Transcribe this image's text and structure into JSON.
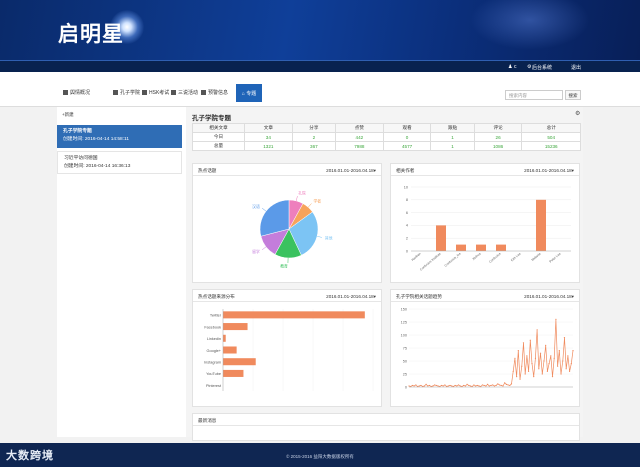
{
  "header": {
    "brand": "启明星"
  },
  "userbar": {
    "user": "c",
    "system": "后台系统",
    "logout": "退出"
  },
  "nav": {
    "tabs": [
      {
        "label": "舆情概况"
      },
      {
        "label": "孔子学院"
      },
      {
        "label": "HSK考试"
      },
      {
        "label": "三说活动"
      },
      {
        "label": "预警信息"
      },
      {
        "label": "专题"
      }
    ],
    "search_placeholder": "搜索内容",
    "search_button": "搜索"
  },
  "sidebar": {
    "new_button": "+新建",
    "items": [
      {
        "title": "孔子学院专题",
        "meta": "创建时间:   2016-04-14 14:58:11"
      },
      {
        "title": "习近平访问德国",
        "meta": "创建时间:   2016-04-14 16:36:13"
      }
    ]
  },
  "main": {
    "title": "孔子学院专题",
    "stats": {
      "headers": [
        "相关文章",
        "文章",
        "分享",
        "点赞",
        "观看",
        "跟贴",
        "评论",
        "总计"
      ],
      "rows": [
        {
          "label": "今日",
          "values": [
            "34",
            "2",
            "442",
            "0",
            "1",
            "26",
            "504"
          ]
        },
        {
          "label": "总量",
          "values": [
            "1321",
            "367",
            "7988",
            "4577",
            "1",
            "1086",
            "15236"
          ]
        }
      ]
    }
  },
  "panels": {
    "hot_topics": {
      "title": "热点话题",
      "range": "2016.01.01-2016.04.18▾"
    },
    "authors": {
      "title": "相关作者",
      "range": "2016.01.01-2016.04.18▾"
    },
    "source": {
      "title": "热点话题来源分布",
      "range": "2016.01.01-2016.04.18▾"
    },
    "trend": {
      "title": "孔子学院相关话题趋势",
      "range": "2016.01.01-2016.04.18▾"
    },
    "latest": {
      "title": "最新消息"
    }
  },
  "footer": {
    "copyright": "© 2015-2016 益阳大数据版权所有"
  },
  "watermark": "大数跨境",
  "colors": {
    "accent": "#1f64b8",
    "bar": "#f08a5d",
    "banner": "#0f3f99"
  },
  "chart_data": [
    {
      "type": "pie",
      "categories": [
        "孔院",
        "学者",
        "其他",
        "教育",
        "留学",
        "汉语"
      ],
      "values": [
        8,
        7,
        28,
        15,
        13,
        29
      ],
      "colors": [
        "#ee7fbd",
        "#f7a35c",
        "#7cc4f4",
        "#3ac25f",
        "#c47ddb",
        "#5b9ae8"
      ]
    },
    {
      "type": "bar",
      "categories": [
        "Hanban",
        "Confucius Institute",
        "Confucius_Ins",
        "Xinhua",
        "Confucius",
        "Kirk Lee",
        "Melanie",
        "Peter Lee"
      ],
      "values": [
        0,
        4,
        1,
        1,
        1,
        0,
        8,
        0
      ],
      "ylim": [
        0,
        10
      ]
    },
    {
      "type": "bar",
      "orientation": "horizontal",
      "categories": [
        "Twitter",
        "Facebook",
        "Linkedin",
        "Google+",
        "Instagram",
        "YouTube",
        "Pinterest"
      ],
      "values": [
        520,
        90,
        10,
        50,
        120,
        75,
        0
      ],
      "xlim": [
        0,
        550
      ]
    },
    {
      "type": "line",
      "ylim": [
        0,
        150
      ],
      "series": [
        {
          "values": [
            2,
            1,
            3,
            2,
            4,
            1,
            2,
            3,
            1,
            2,
            5,
            2,
            3,
            1,
            2,
            4,
            3,
            2,
            1,
            3,
            2,
            4,
            1,
            2,
            3,
            2,
            1,
            3,
            2,
            4,
            2,
            1,
            3,
            2,
            5,
            3,
            2,
            1,
            4,
            2,
            3,
            2,
            1,
            4,
            3,
            2,
            5,
            2,
            3,
            4,
            2,
            3,
            6,
            4,
            3,
            2,
            8,
            5,
            4,
            3,
            6,
            30,
            55,
            20,
            70,
            15,
            40,
            85,
            25,
            60,
            30,
            90,
            45,
            20,
            55,
            110,
            35,
            65,
            25,
            50,
            80,
            30,
            45,
            60,
            20,
            55,
            130,
            40,
            70,
            25,
            50,
            95,
            35,
            60,
            30,
            45,
            70
          ]
        }
      ]
    }
  ]
}
